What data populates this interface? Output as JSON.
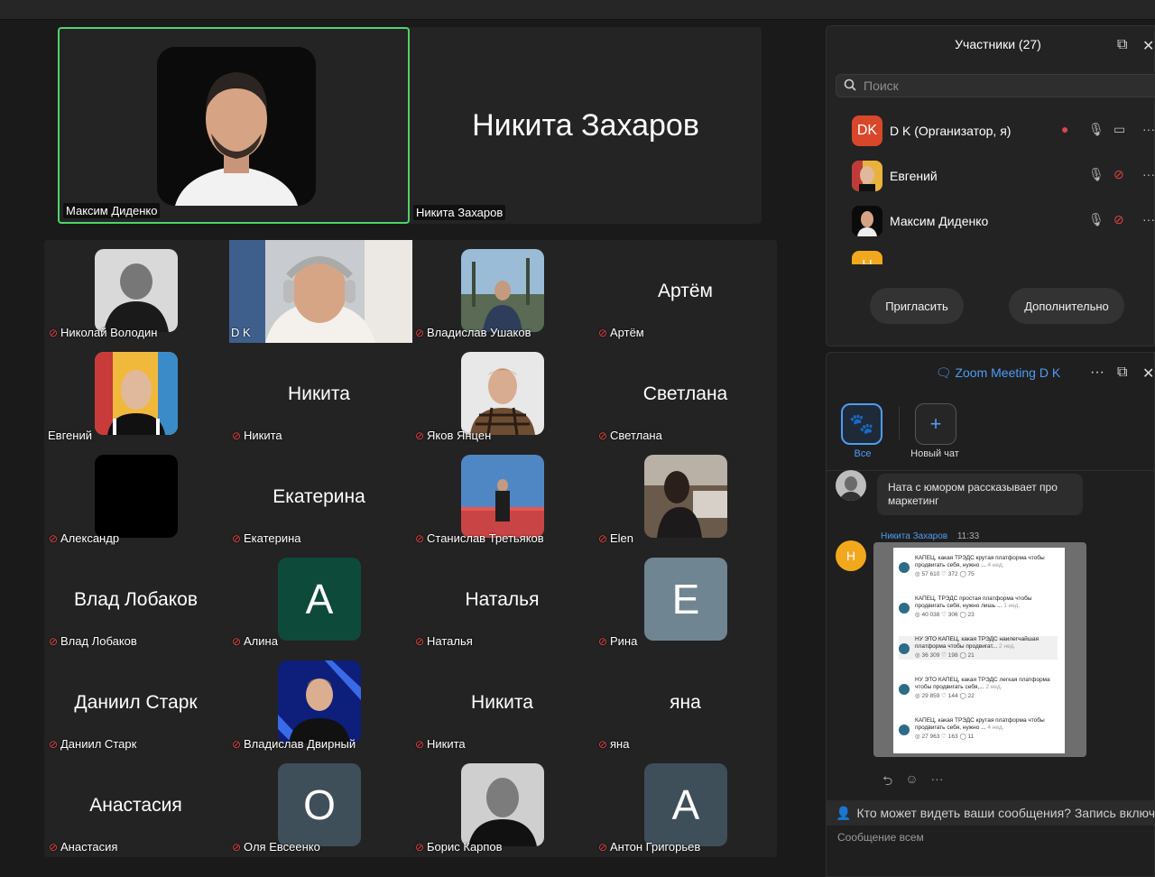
{
  "speakers": [
    {
      "name": "Максим Диденко",
      "active": true,
      "has_photo": true
    },
    {
      "name": "Никита Захаров",
      "big_name": "Никита Захаров",
      "active": false,
      "has_photo": false
    }
  ],
  "grid": [
    {
      "label": "Николай Володин",
      "muted": true,
      "kind": "photo",
      "photo": "bald-dark"
    },
    {
      "label": "D K",
      "muted": false,
      "kind": "video"
    },
    {
      "label": "Владислав Ушаков",
      "muted": true,
      "kind": "photo",
      "photo": "outdoor"
    },
    {
      "label": "Артём",
      "muted": true,
      "kind": "name",
      "big": "Артём"
    },
    {
      "label": "Евгений",
      "muted": false,
      "kind": "photo",
      "photo": "colorful"
    },
    {
      "label": "Никита",
      "muted": true,
      "kind": "name",
      "big": "Никита"
    },
    {
      "label": "Яков Янцен",
      "muted": true,
      "kind": "photo",
      "photo": "plaid"
    },
    {
      "label": "Светлана",
      "muted": true,
      "kind": "name",
      "big": "Светлана"
    },
    {
      "label": "Александр",
      "muted": true,
      "kind": "photo",
      "photo": "black"
    },
    {
      "label": "Екатерина",
      "muted": true,
      "kind": "name",
      "big": "Екатерина"
    },
    {
      "label": "Станислав Третьяков",
      "muted": true,
      "kind": "photo",
      "photo": "sky"
    },
    {
      "label": "Elen",
      "muted": true,
      "kind": "photo",
      "photo": "cafe"
    },
    {
      "label": "Влад Лобаков",
      "muted": true,
      "kind": "name",
      "big": "Влад Лобаков"
    },
    {
      "label": "Алина",
      "muted": true,
      "kind": "letter",
      "letter": "A",
      "color": "#0d4a3a"
    },
    {
      "label": "Наталья",
      "muted": true,
      "kind": "name",
      "big": "Наталья"
    },
    {
      "label": "Рина",
      "muted": true,
      "kind": "letter",
      "letter": "E",
      "color": "#6f8591"
    },
    {
      "label": "Даниил Старк",
      "muted": true,
      "kind": "name",
      "big": "Даниил Старк"
    },
    {
      "label": "Владислав Двирный",
      "muted": true,
      "kind": "photo",
      "photo": "blue"
    },
    {
      "label": "Никита",
      "muted": true,
      "kind": "name",
      "big": "Никита"
    },
    {
      "label": "яна",
      "muted": true,
      "kind": "name",
      "big": "яна"
    },
    {
      "label": "Анастасия",
      "muted": true,
      "kind": "name",
      "big": "Анастасия"
    },
    {
      "label": "Оля Евсеенко",
      "muted": true,
      "kind": "letter",
      "letter": "O",
      "color": "#3f4f5a"
    },
    {
      "label": "Борис Карпов",
      "muted": true,
      "kind": "photo",
      "photo": "bw"
    },
    {
      "label": "Антон Григорьев",
      "muted": true,
      "kind": "letter",
      "letter": "A",
      "color": "#3f4f5a"
    }
  ],
  "participants": {
    "title": "Участники (27)",
    "search_placeholder": "Поиск",
    "rows": [
      {
        "name": "D K (Организатор, я)",
        "avatar_text": "DK",
        "avatar_color": "#d9472b"
      },
      {
        "name": "Евгений",
        "avatar_text": "",
        "avatar_color": "#c96a3a"
      },
      {
        "name": "Максим Диденко",
        "avatar_text": "",
        "avatar_color": "#111111"
      },
      {
        "name": "",
        "avatar_text": "Н",
        "avatar_color": "#f2a81d"
      }
    ],
    "invite_label": "Пригласить",
    "more_label": "Дополнительно"
  },
  "chat": {
    "title": "Zoom Meeting D K",
    "tab_all": "Все",
    "tab_new": "Новый чат",
    "bubble_text": "Ната с юмором рассказывает про маркетинг",
    "sender": "Никита Захаров",
    "time": "11:33",
    "sender_initial": "Н",
    "posts": [
      {
        "text": "КАПЕЦ, какая ТРЭДС крутая платформа чтобы продвигать себя, нужно ...",
        "age": "4 нед.",
        "stats": "◎ 57 610   ♡ 372   ◯ 75"
      },
      {
        "text": "КАПЕЦ, ТРЭДС простая платформа чтобы продвигать себя, нужно лишь ...",
        "age": "1 нед.",
        "stats": "◎ 40 038   ♡ 306   ◯ 23"
      },
      {
        "text": "НУ ЭТО КАПЕЦ, какая ТРЭДС наилегчайшая платформа чтобы продвигат...",
        "age": "2 нед.",
        "stats": "◎ 36 309   ♡ 198   ◯ 21"
      },
      {
        "text": "НУ ЭТО КАПЕЦ, какая ТРЭДС легкая платформа чтобы продвигать себя,...",
        "age": "2 нед.",
        "stats": "◎ 29 859   ♡ 144   ◯ 22"
      },
      {
        "text": "КАПЕЦ, какая ТРЭДС крутая платформа чтобы продвигать себя, нужно ...",
        "age": "4 нед.",
        "stats": "◎ 27 963   ♡ 163   ◯ 11"
      }
    ],
    "privacy_text": "Кто может видеть ваши сообщения? Запись включ...",
    "composer_placeholder": "Сообщение всем"
  },
  "colors": {
    "active_border": "#4ed46a",
    "accent": "#4d9cf5",
    "muted_icon": "#e34242"
  }
}
